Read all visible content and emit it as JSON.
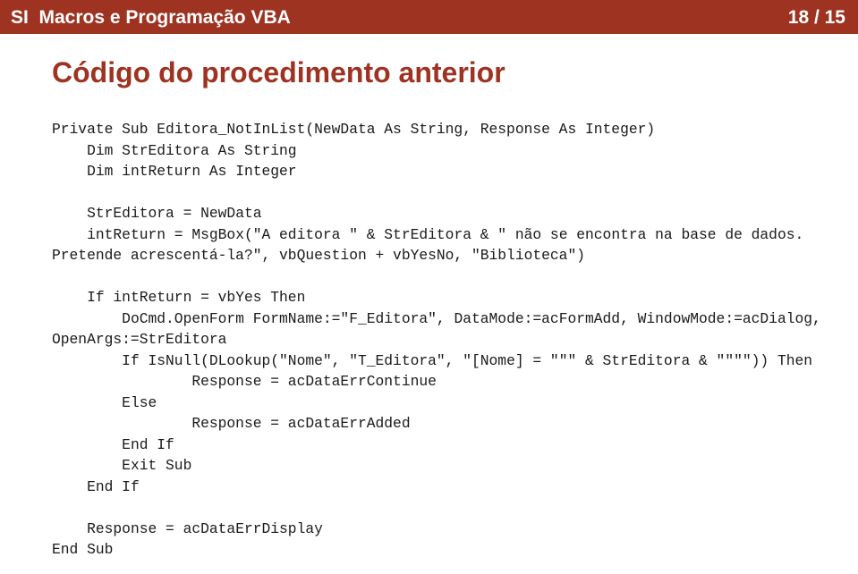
{
  "header": {
    "title": "SI  Macros e Programação VBA",
    "page_indicator": "18 / 15",
    "background_color": "#9E3322",
    "text_color": "#FFFFFF"
  },
  "slide": {
    "heading": "Código do procedimento anterior",
    "heading_color": "#9E3322",
    "code_color": "#1A1A1A",
    "code_language": "VBA",
    "code": "Private Sub Editora_NotInList(NewData As String, Response As Integer)\n    Dim StrEditora As String\n    Dim intReturn As Integer\n\n    StrEditora = NewData\n    intReturn = MsgBox(\"A editora \" & StrEditora & \" não se encontra na base de dados. Pretende acrescentá-la?\", vbQuestion + vbYesNo, \"Biblioteca\")\n\n    If intReturn = vbYes Then\n        DoCmd.OpenForm FormName:=\"F_Editora\", DataMode:=acFormAdd, WindowMode:=acDialog, OpenArgs:=StrEditora\n        If IsNull(DLookup(\"Nome\", \"T_Editora\", \"[Nome] = \"\"\" & StrEditora & \"\"\"\")) Then\n                Response = acDataErrContinue\n        Else\n                Response = acDataErrAdded\n        End If\n        Exit Sub\n    End If\n\n    Response = acDataErrDisplay\nEnd Sub"
  }
}
